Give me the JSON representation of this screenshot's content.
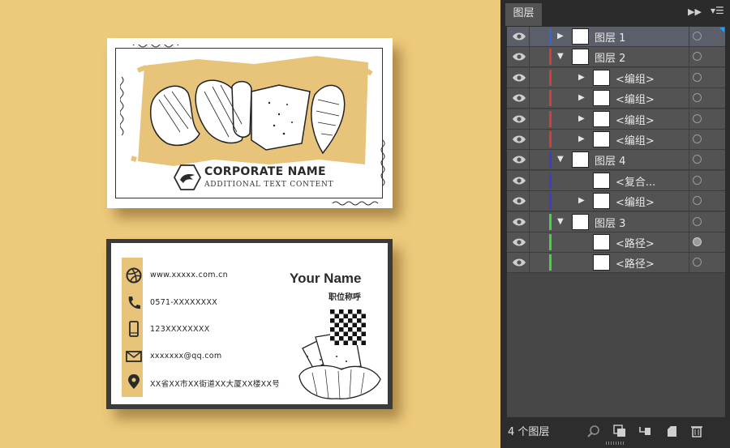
{
  "canvas": {
    "front_card": {
      "corporate_name": "CORPORATE NAME",
      "additional_text": "ADDITIONAL TEXT CONTENT"
    },
    "back_card": {
      "your_name": "Your Name",
      "job_title": "职位称呼",
      "contacts": [
        {
          "icon": "dribbble-icon",
          "text": "www.xxxxx.com.cn"
        },
        {
          "icon": "phone-icon",
          "text": "0571-XXXXXXXX"
        },
        {
          "icon": "mobile-icon",
          "text": "123XXXXXXXX"
        },
        {
          "icon": "mail-icon",
          "text": "xxxxxxx@qq.com"
        },
        {
          "icon": "location-pin-icon",
          "text": "XX省XX市XX街道XX大厦XX楼XX号"
        }
      ]
    },
    "colors": {
      "background": "#edc97b",
      "accent": "#e8c37a",
      "card_border": "#3b3b3b"
    }
  },
  "panel": {
    "tab": "图层",
    "expand_icon": "double-chevron-right-icon",
    "menu_icon": "panel-menu-icon",
    "rows": [
      {
        "name": "图层 1",
        "toggle": "collapsed",
        "color": "#3b63d6",
        "selected": true
      },
      {
        "name": "图层 2",
        "toggle": "expanded",
        "color": "#d93a3a",
        "selected": false
      },
      {
        "name": "<编组>",
        "toggle": "collapsed",
        "color": "#d93a3a",
        "selected": false
      },
      {
        "name": "<编组>",
        "toggle": "collapsed",
        "color": "#d93a3a",
        "selected": false
      },
      {
        "name": "<编组>",
        "toggle": "collapsed",
        "color": "#d93a3a",
        "selected": false
      },
      {
        "name": "<编组>",
        "toggle": "collapsed",
        "color": "#d93a3a",
        "selected": false
      },
      {
        "name": "图层 4",
        "toggle": "expanded",
        "color": "#3b3bd6",
        "selected": false
      },
      {
        "name": "<复合...",
        "toggle": "none",
        "color": "#3b3bd6",
        "selected": false
      },
      {
        "name": "<编组>",
        "toggle": "collapsed",
        "color": "#3b3bd6",
        "selected": false
      },
      {
        "name": "图层 3",
        "toggle": "expanded",
        "color": "#3fd63f",
        "selected": false
      },
      {
        "name": "<路径>",
        "toggle": "none",
        "color": "#3fd63f",
        "selected": false
      },
      {
        "name": "<路径>",
        "toggle": "none",
        "color": "#3fd63f",
        "selected": false
      }
    ],
    "footer": {
      "layer_count": "4 个图层",
      "buttons": [
        "locate-object-icon",
        "make-clipping-mask-icon",
        "create-sublayer-icon",
        "new-layer-icon",
        "trash-icon"
      ]
    }
  }
}
